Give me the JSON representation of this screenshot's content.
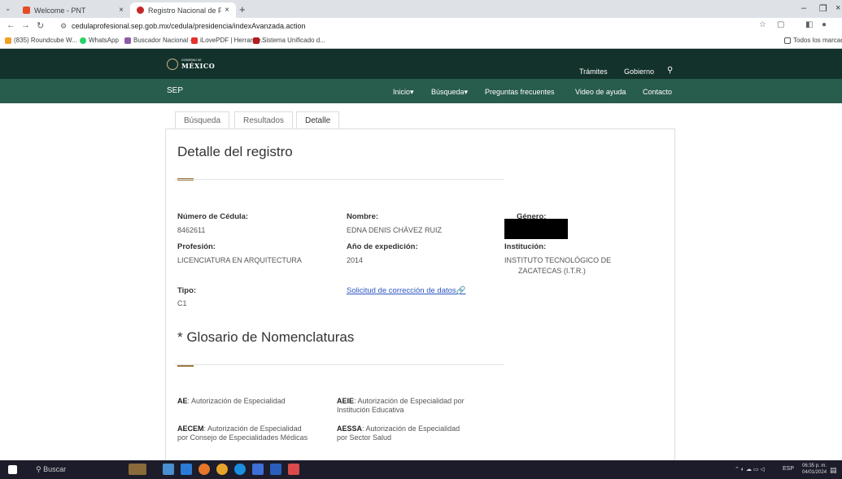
{
  "browser": {
    "tabs": [
      {
        "title": "Welcome - PNT",
        "favicon": "pnt-icon"
      },
      {
        "title": "Registro Nacional de Profesion",
        "favicon": "sep-icon"
      }
    ],
    "url": "cedulaprofesional.sep.gob.mx/cedula/presidencia/indexAvanzada.action",
    "bookmarks": [
      "(835) Roundcube W...",
      "WhatsApp",
      "Buscador Nacional -...",
      "iLovePDF | Herramie...",
      "Sistema Unificado d..."
    ],
    "bookmarks_folder": "Todos los marcadores"
  },
  "gov_header": {
    "logo_top": "GOBIERNO DE",
    "logo_main": "MÉXICO",
    "links": [
      "Trámites",
      "Gobierno"
    ]
  },
  "sep_header": {
    "label": "SEP",
    "nav": [
      "Inicio",
      "Búsqueda",
      "Preguntas frecuentes",
      "Video de ayuda",
      "Contacto"
    ]
  },
  "page_tabs": [
    "Búsqueda",
    "Resultados",
    "Detalle"
  ],
  "detail": {
    "title": "Detalle del registro",
    "fields": {
      "cedula_label": "Número de Cédula:",
      "cedula_value": "8462611",
      "nombre_label": "Nombre:",
      "nombre_value": "EDNA DENIS CHÁVEZ RUIZ",
      "genero_label": "Género:",
      "profesion_label": "Profesión:",
      "profesion_value": "LICENCIATURA EN ARQUITECTURA",
      "anio_label": "Año de expedición:",
      "anio_value": "2014",
      "institucion_label": "Institución:",
      "institucion_value_1": "INSTITUTO TECNOLÓGICO DE",
      "institucion_value_2": "ZACATECAS (I.T.R.)",
      "tipo_label": "Tipo:",
      "tipo_value": "C1",
      "correction_link": "Solicitud de corrección de datos"
    }
  },
  "glossary": {
    "title": "* Glosario de Nomenclaturas",
    "items": [
      {
        "code": "AE",
        "desc1": "Autorización de Especialidad",
        "desc2": ""
      },
      {
        "code": "AEIE",
        "desc1": "Autorización de Especialidad por",
        "desc2": "Institución Educativa"
      },
      {
        "code": "AECEM",
        "desc1": "Autorización de Especialidad",
        "desc2": "por Consejo de Especialidades Médicas"
      },
      {
        "code": "AESSA",
        "desc1": "Autorización de Especialidad",
        "desc2": "por Sector Salud"
      }
    ]
  },
  "taskbar": {
    "search": "Buscar",
    "lang": "ESP",
    "time": "06:35 p. m.",
    "date": "04/01/2024"
  },
  "colors": {
    "gov_green": "#13322b",
    "sep_green": "#285c4d",
    "accent_gold": "#9d7945",
    "link_blue": "#2b56c1"
  }
}
